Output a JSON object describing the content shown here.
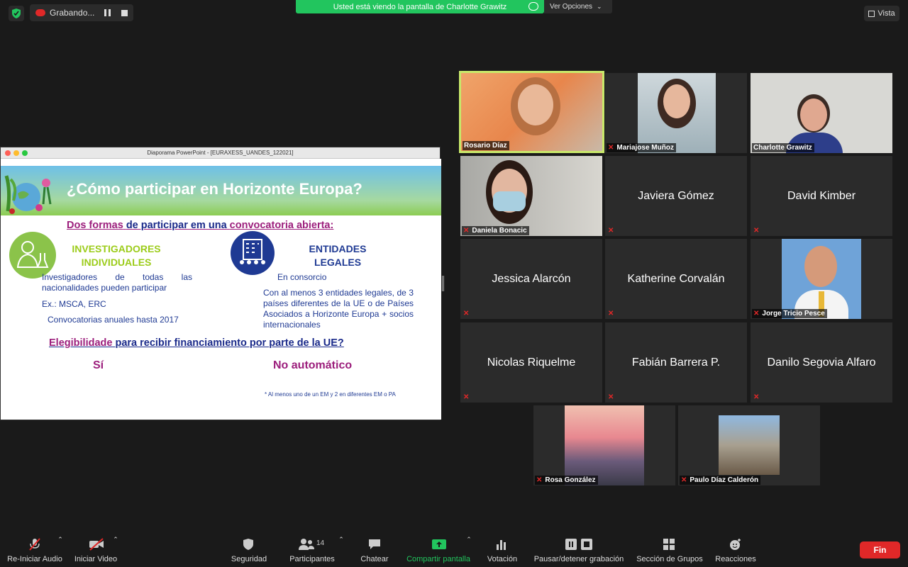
{
  "top": {
    "recording_label": "Grabando...",
    "share_banner": "Usted está viendo la pantalla de Charlotte Grawitz",
    "options_label": "Ver Opciones",
    "view_label": "Vista"
  },
  "slide": {
    "window_title": "Diaporama PowerPoint - [EURAXESS_UANDES_122021]",
    "title": "¿Cómo participar en Horizonte Europa?",
    "subtitle_a": "Dos formas",
    "subtitle_b": "de participar em una",
    "subtitle_c": "convocatoria abierta:",
    "left_heading": "INVESTIGADORES INDIVIDUALES",
    "left_text_1": "Investigadores de todas las nacionalidades pueden participar",
    "left_text_2": "Ex.: MSCA, ERC",
    "left_text_3": "Convocatorias anuales hasta 2017",
    "right_heading": "ENTIDADES LEGALES",
    "right_text_1": "En consorcio",
    "right_text_2": "Con al menos 3 entidades legales, de 3 países diferentes de la UE o de Países Asociados a Horizonte Europa + socios internacionales",
    "eligibility_a": "Elegibilidade",
    "eligibility_b": "para recibir financiamiento por parte de la UE?",
    "answer_left": "Sí",
    "answer_right": "No automático",
    "footnote": "* Al menos uno de un EM y 2 en diferentes EM o PA"
  },
  "participants": [
    {
      "name": "Rosario Díaz",
      "video": true,
      "muted": false,
      "active": true
    },
    {
      "name": "Mariajose Muñoz",
      "video": true,
      "muted": true
    },
    {
      "name": "Charlotte Grawitz",
      "video": true,
      "muted": false
    },
    {
      "name": "Daniela Bonacic",
      "video": true,
      "muted": true
    },
    {
      "name": "Javiera Gómez",
      "video": false,
      "muted": true
    },
    {
      "name": "David Kimber",
      "video": false,
      "muted": true
    },
    {
      "name": "Jessica Alarcón",
      "video": false,
      "muted": true
    },
    {
      "name": "Katherine Corvalán",
      "video": false,
      "muted": true
    },
    {
      "name": "Jorge Tricio Pesce",
      "video": true,
      "muted": true
    },
    {
      "name": "Nicolas Riquelme",
      "video": false,
      "muted": true
    },
    {
      "name": "Fabián Barrera P.",
      "video": false,
      "muted": true
    },
    {
      "name": "Danilo Segovia Alfaro",
      "video": false,
      "muted": true
    },
    {
      "name": "Rosa González",
      "video": true,
      "muted": true
    },
    {
      "name": "Paulo Díaz Calderón",
      "video": true,
      "muted": true
    }
  ],
  "toolbar": {
    "audio": "Re-Iniciar Audio",
    "video": "Iniciar Video",
    "security": "Seguridad",
    "participants": "Participantes",
    "participants_count": "14",
    "chat": "Chatear",
    "share": "Compartir pantalla",
    "poll": "Votación",
    "record": "Pausar/detener grabación",
    "groups": "Sección de Grupos",
    "reactions": "Reacciones",
    "end": "Fin"
  },
  "colors": {
    "share_green": "#22c55e",
    "end_red": "#e02828",
    "active_border": "#c8e86a"
  }
}
